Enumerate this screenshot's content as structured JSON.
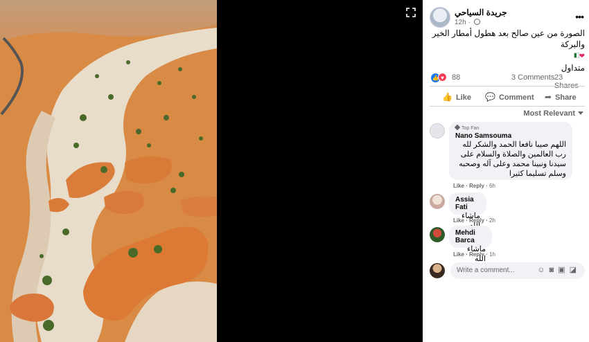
{
  "viewer": {
    "expand_icon": "expand-icon"
  },
  "post": {
    "page_name": "جريدة السياحي",
    "time": "12h",
    "caption_line1": "الصورة من عين صالح بعد هطول أمطار الخير والبركة",
    "caption_line2": "متداول",
    "reaction_count": "88",
    "comments_count": "3 Comments",
    "shares_count": "23 Shares",
    "more_icon": "more-dots-icon"
  },
  "actions": {
    "like": "Like",
    "comment": "Comment",
    "share": "Share"
  },
  "sort": {
    "label": "Most Relevant"
  },
  "comments": [
    {
      "badge": "Top Fan",
      "name": "Nano Samsouma",
      "text": "اللهم صيبا نافعا الحمد والشكر لله رب العالمين والصلاة والسلام على سيدنا ونبينا محمد وعلى آله وصحبه وسلم تسليما كثيرا",
      "like": "Like",
      "reply": "Reply",
      "time": "6h"
    },
    {
      "name": "Assia Fati",
      "text": "ماشاء الله",
      "like": "Like",
      "reply": "Reply",
      "time": "2h"
    },
    {
      "name": "Mehdi Barca",
      "text": "ماشاء الله",
      "like": "Like",
      "reply": "Reply",
      "time": "1h"
    }
  ],
  "composer": {
    "placeholder": "Write a comment..."
  },
  "colors": {
    "accent": "#1877f2",
    "love": "#f33e58",
    "bubble": "#f0f2f5"
  }
}
